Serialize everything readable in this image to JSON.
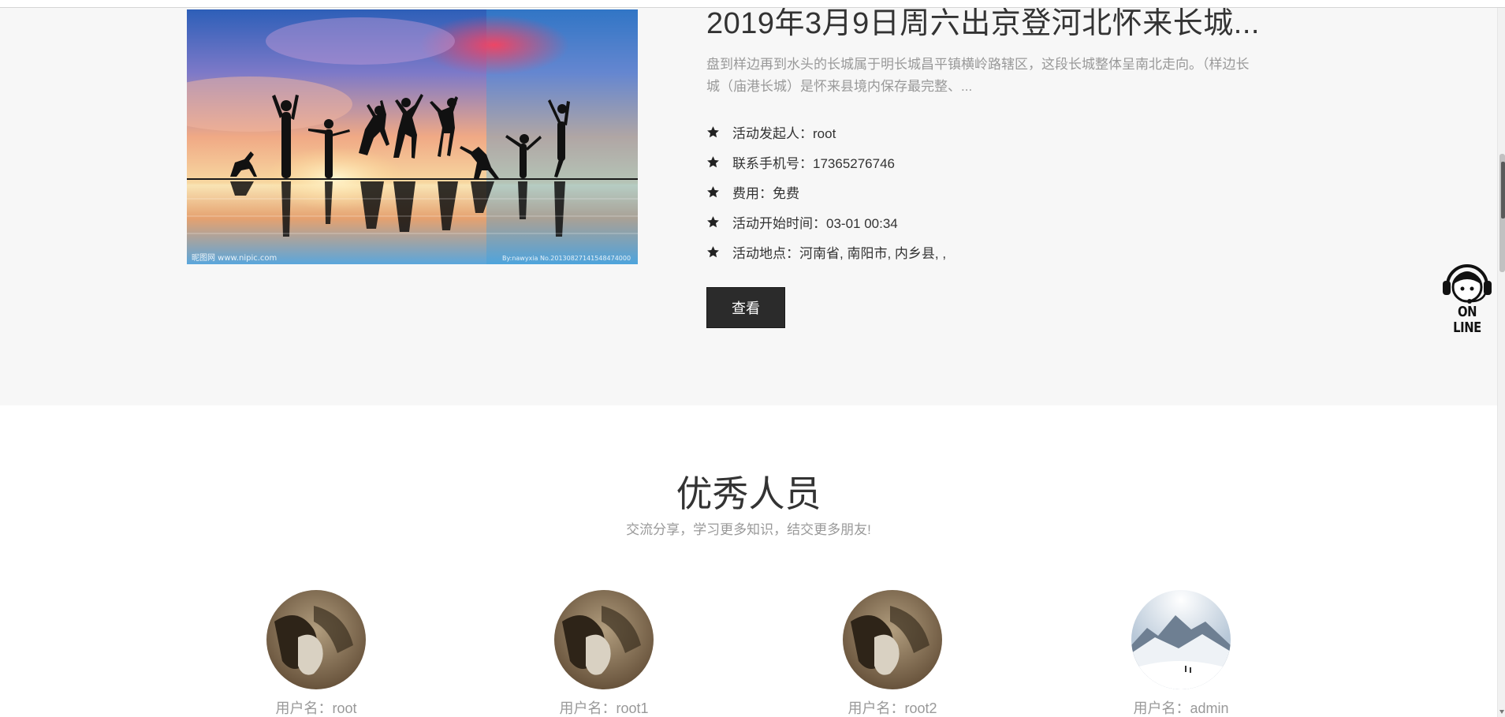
{
  "activity": {
    "title": "2019年3月9日周六出京登河北怀来长城...",
    "description": "盘到样边再到水头的长城属于明长城昌平镇横岭路辖区，这段长城整体呈南北走向。（样边长城（庙港长城）是怀来县境内保存最完整、...",
    "image_watermark_left": "昵图网 www.nipic.com",
    "image_watermark_right": "By:nawyxia  No.20130827141548474000",
    "info": [
      {
        "icon": "star-icon",
        "text": "活动发起人：root"
      },
      {
        "icon": "star-icon",
        "text": "联系手机号：17365276746"
      },
      {
        "icon": "star-icon",
        "text": "费用：免费"
      },
      {
        "icon": "star-icon",
        "text": "活动开始时间：03-01 00:34"
      },
      {
        "icon": "star-icon",
        "text": "活动地点：河南省, 南阳市, 内乡县, ,"
      }
    ],
    "view_button": "查看"
  },
  "online_widget": {
    "label": "ON LINE",
    "icon": "headset-support-icon"
  },
  "members": {
    "title": "优秀人员",
    "subtitle": "交流分享，学习更多知识，结交更多朋友!",
    "items": [
      {
        "name": "用户名：root",
        "avatar": "photo-avatar"
      },
      {
        "name": "用户名：root1",
        "avatar": "photo-avatar"
      },
      {
        "name": "用户名：root2",
        "avatar": "photo-avatar"
      },
      {
        "name": "用户名：admin",
        "avatar": "snow-mountain-avatar"
      }
    ]
  },
  "colors": {
    "activity_background": "#f7f7f7",
    "button_background": "#2b2b2b",
    "muted_text": "#999999",
    "body_text": "#333333"
  }
}
